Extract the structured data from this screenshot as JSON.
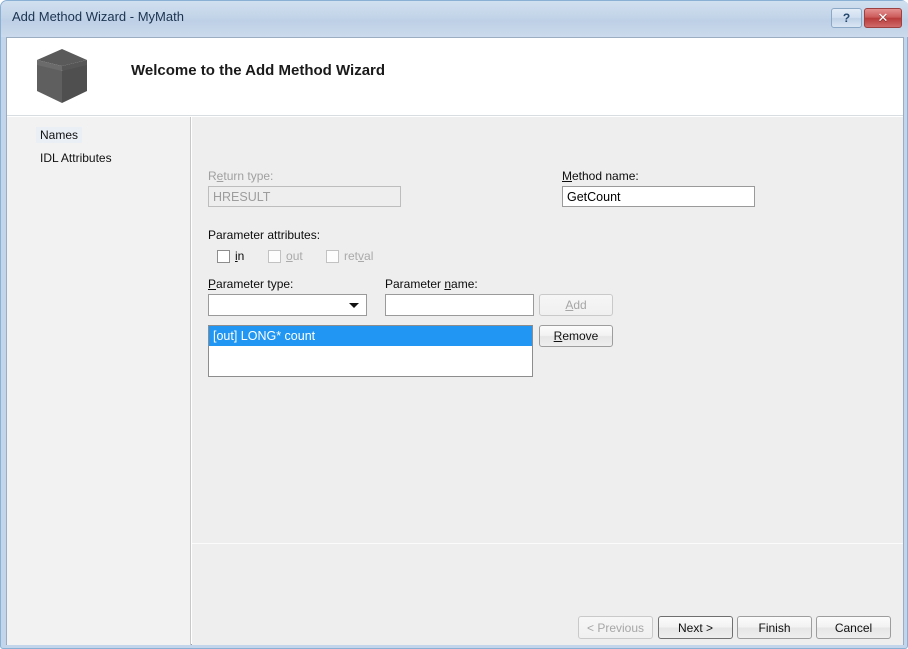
{
  "window": {
    "title": "Add Method Wizard - MyMath",
    "help_button": "?",
    "close_button": "✕"
  },
  "header": {
    "title": "Welcome to the Add Method Wizard",
    "icon": "cube-icon"
  },
  "sidebar": {
    "items": [
      {
        "label": "Names",
        "selected": true
      },
      {
        "label": "IDL Attributes",
        "selected": false
      }
    ]
  },
  "form": {
    "return_type": {
      "label_pre": "R",
      "label_accel": "e",
      "label_post": "turn type:",
      "value": "HRESULT",
      "enabled": false
    },
    "method_name": {
      "label_accel": "M",
      "label_post": "ethod name:",
      "value": "GetCount",
      "enabled": true
    },
    "parameter_attributes": {
      "label": "Parameter attributes:",
      "checkboxes": [
        {
          "pre": "",
          "accel": "i",
          "post": "n",
          "checked": false,
          "enabled": true
        },
        {
          "pre": "",
          "accel": "o",
          "post": "ut",
          "checked": false,
          "enabled": false
        },
        {
          "pre": "ret",
          "accel": "v",
          "post": "al",
          "checked": false,
          "enabled": false
        }
      ]
    },
    "parameter_type": {
      "label_accel": "P",
      "label_post": "arameter type:",
      "value": "",
      "enabled": true
    },
    "parameter_name": {
      "label_pre": "Parameter ",
      "label_accel": "n",
      "label_post": "ame:",
      "value": "",
      "enabled": true
    },
    "add_button": {
      "pre": "",
      "accel": "A",
      "post": "dd",
      "enabled": false
    },
    "remove_button": {
      "pre": "",
      "accel": "R",
      "post": "emove",
      "enabled": true
    },
    "parameter_list": {
      "items": [
        {
          "text": "[out] LONG* count",
          "selected": true
        }
      ]
    }
  },
  "footer": {
    "buttons": [
      {
        "label": "< Previous",
        "enabled": false,
        "default": false
      },
      {
        "label": "Next >",
        "enabled": true,
        "default": true
      },
      {
        "label": "Finish",
        "enabled": true,
        "default": false
      },
      {
        "label": "Cancel",
        "enabled": true,
        "default": false
      }
    ]
  },
  "colors": {
    "selection_blue": "#2196f3",
    "window_frame": "#c3d5ea",
    "panel_gray": "#eeeeee",
    "sidebar_gray": "#f2f2f2",
    "close_red": "#cc5b5b"
  }
}
